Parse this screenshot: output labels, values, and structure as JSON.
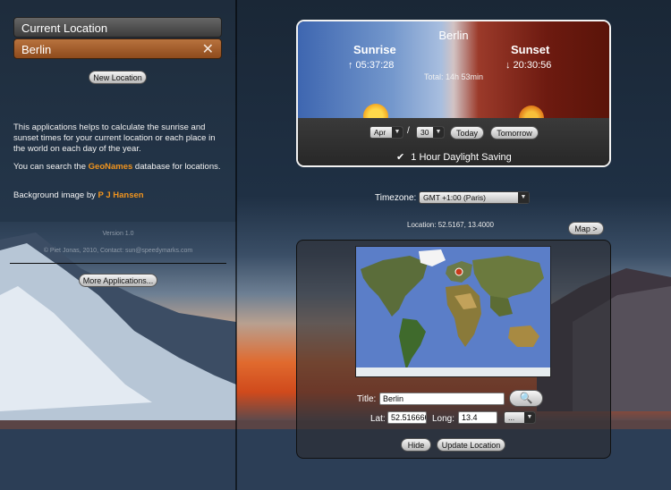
{
  "sidebar": {
    "current_location_label": "Current Location",
    "selected_location": "Berlin",
    "new_location_button": "New Location",
    "info_1": "This applications helps to calculate the sunrise and sunset times for your current location or each place in the world on each day of the year.",
    "info_2_pre": "You can search the ",
    "info_2_link": "GeoNames",
    "info_2_post": " database for locations.",
    "bg_credit_pre": "Background image by ",
    "bg_credit_link": "P J Hansen",
    "version": "Version 1.0",
    "copyright": "© Piet Jonas, 2010, Contact: sun@speedymarks.com",
    "more_apps_button": "More Applications..."
  },
  "sun": {
    "city": "Berlin",
    "sunrise_label": "Sunrise",
    "sunrise_time": "↑  05:37:28",
    "sunset_label": "Sunset",
    "sunset_time": "↓  20:30:56",
    "total": "Total: 14h 53min",
    "month": "Apr",
    "date_sep": "/",
    "day": "30",
    "today_button": "Today",
    "tomorrow_button": "Tomorrow",
    "dst_label": "1 Hour Daylight Saving",
    "dst_checked": true
  },
  "timezone": {
    "label": "Timezone:",
    "value": "GMT +1:00 (Paris)"
  },
  "location_line": "Location:  52.5167,  13.4000",
  "map_button": "Map >",
  "form": {
    "title_label": "Title:",
    "title_value": "Berlin",
    "lat_label": "Lat:",
    "lat_value": "52.516666",
    "long_label": "Long:",
    "long_value": "13.4",
    "more_select": "...",
    "hide_button": "Hide",
    "update_button": "Update Location"
  },
  "icons": {
    "close": "close-icon",
    "search": "search-icon",
    "checkbox": "checkbox-icon",
    "pin": "map-pin-icon"
  },
  "colors": {
    "accent_orange": "#f0941e",
    "selected_row": "#a25e2c"
  }
}
